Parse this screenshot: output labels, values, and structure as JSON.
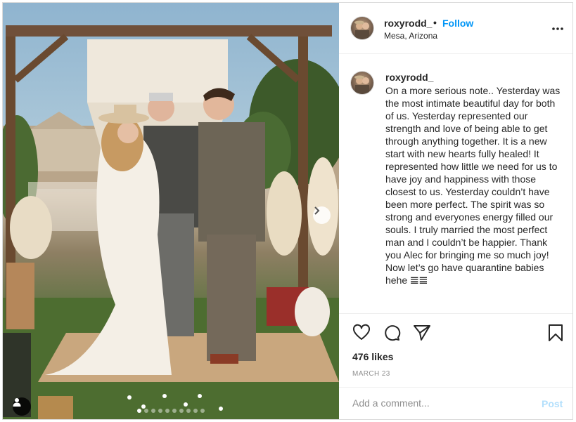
{
  "post": {
    "username": "roxyrodd_",
    "separator": "•",
    "follow_label": "Follow",
    "location": "Mesa, Arizona",
    "caption": "On a more serious note.. Yesterday was the most intimate beautiful day for both of us. Yesterday represented our strength and love of being able to get through anything together. It is a new start with new hearts fully healed! It represented how little we need for us to have joy and happiness with those closest to us. Yesterday couldn’t have been more perfect. The spirit was so strong and everyones energy filled our souls. I truly married the most perfect man and I couldn’t be happier. Thank you Alec for bringing me so much joy! Now let’s go have quarantine babies hehe 𝌆𝌆",
    "likes": "476 likes",
    "date": "MARCH 23"
  },
  "comment": {
    "placeholder": "Add a comment...",
    "post_label": "Post"
  },
  "carousel": {
    "total_slides": 10,
    "active_slide": 1
  },
  "icons": {
    "more": "more-options-icon",
    "like": "heart-icon",
    "comment": "comment-icon",
    "share": "paper-plane-icon",
    "save": "bookmark-icon",
    "next": "chevron-right-icon",
    "tags": "user-tag-icon"
  },
  "colors": {
    "link": "#0095f6",
    "post_disabled": "#b2dffc",
    "muted": "#8e8e8e"
  }
}
